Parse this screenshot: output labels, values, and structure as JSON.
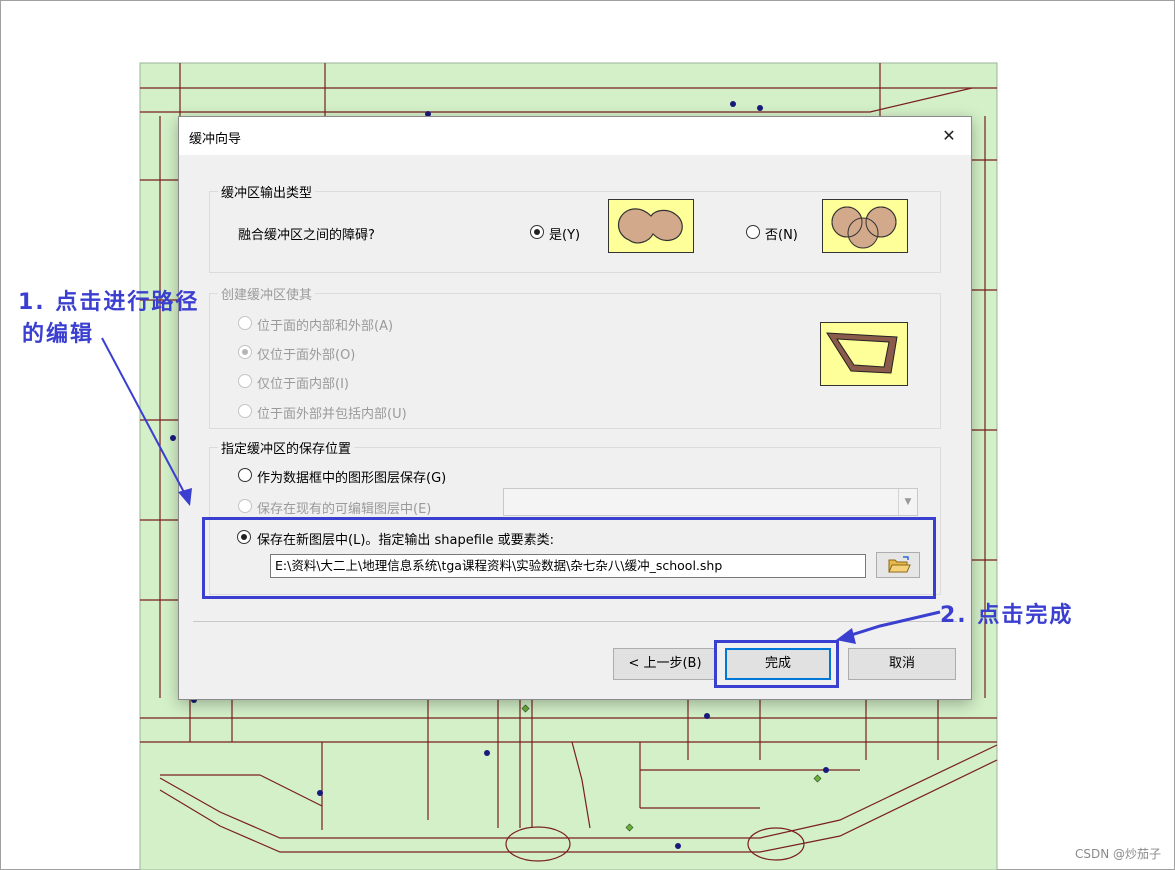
{
  "dialog": {
    "title": "缓冲向导",
    "close_glyph": "✕",
    "section1": {
      "title": "缓冲区输出类型",
      "question": "融合缓冲区之间的障碍?",
      "yes_label": "是(Y)",
      "no_label": "否(N)",
      "selected": "yes"
    },
    "section2": {
      "title": "创建缓冲区使其",
      "options": [
        {
          "label": "位于面的内部和外部(A)",
          "checked": false
        },
        {
          "label": "仅位于面外部(O)",
          "checked": true
        },
        {
          "label": "仅位于面内部(I)",
          "checked": false
        },
        {
          "label": "位于面外部并包括内部(U)",
          "checked": false
        }
      ]
    },
    "section3": {
      "title": "指定缓冲区的保存位置",
      "option_graphic": "作为数据框中的图形图层保存(G)",
      "option_existing": "保存在现有的可编辑图层中(E)",
      "option_new": "保存在新图层中(L)。指定输出 shapefile 或要素类:",
      "output_path": "E:\\资料\\大二上\\地理信息系统\\tga课程资料\\实验数据\\杂七杂八\\缓冲_school.shp"
    },
    "buttons": {
      "back": "< 上一步(B)",
      "finish": "完成",
      "cancel": "取消"
    }
  },
  "annotations": {
    "step1_line1": "1. 点击进行路径",
    "step1_line2": "的编辑",
    "step2": "2. 点击完成"
  },
  "colors": {
    "map_background": "#d3f0c8",
    "road": "#7a1f1f",
    "annotation": "#3b3fd0",
    "preview_fill": "#ffff99",
    "buffer_fill": "#d2a98a"
  },
  "watermark": "CSDN @炒茄子"
}
